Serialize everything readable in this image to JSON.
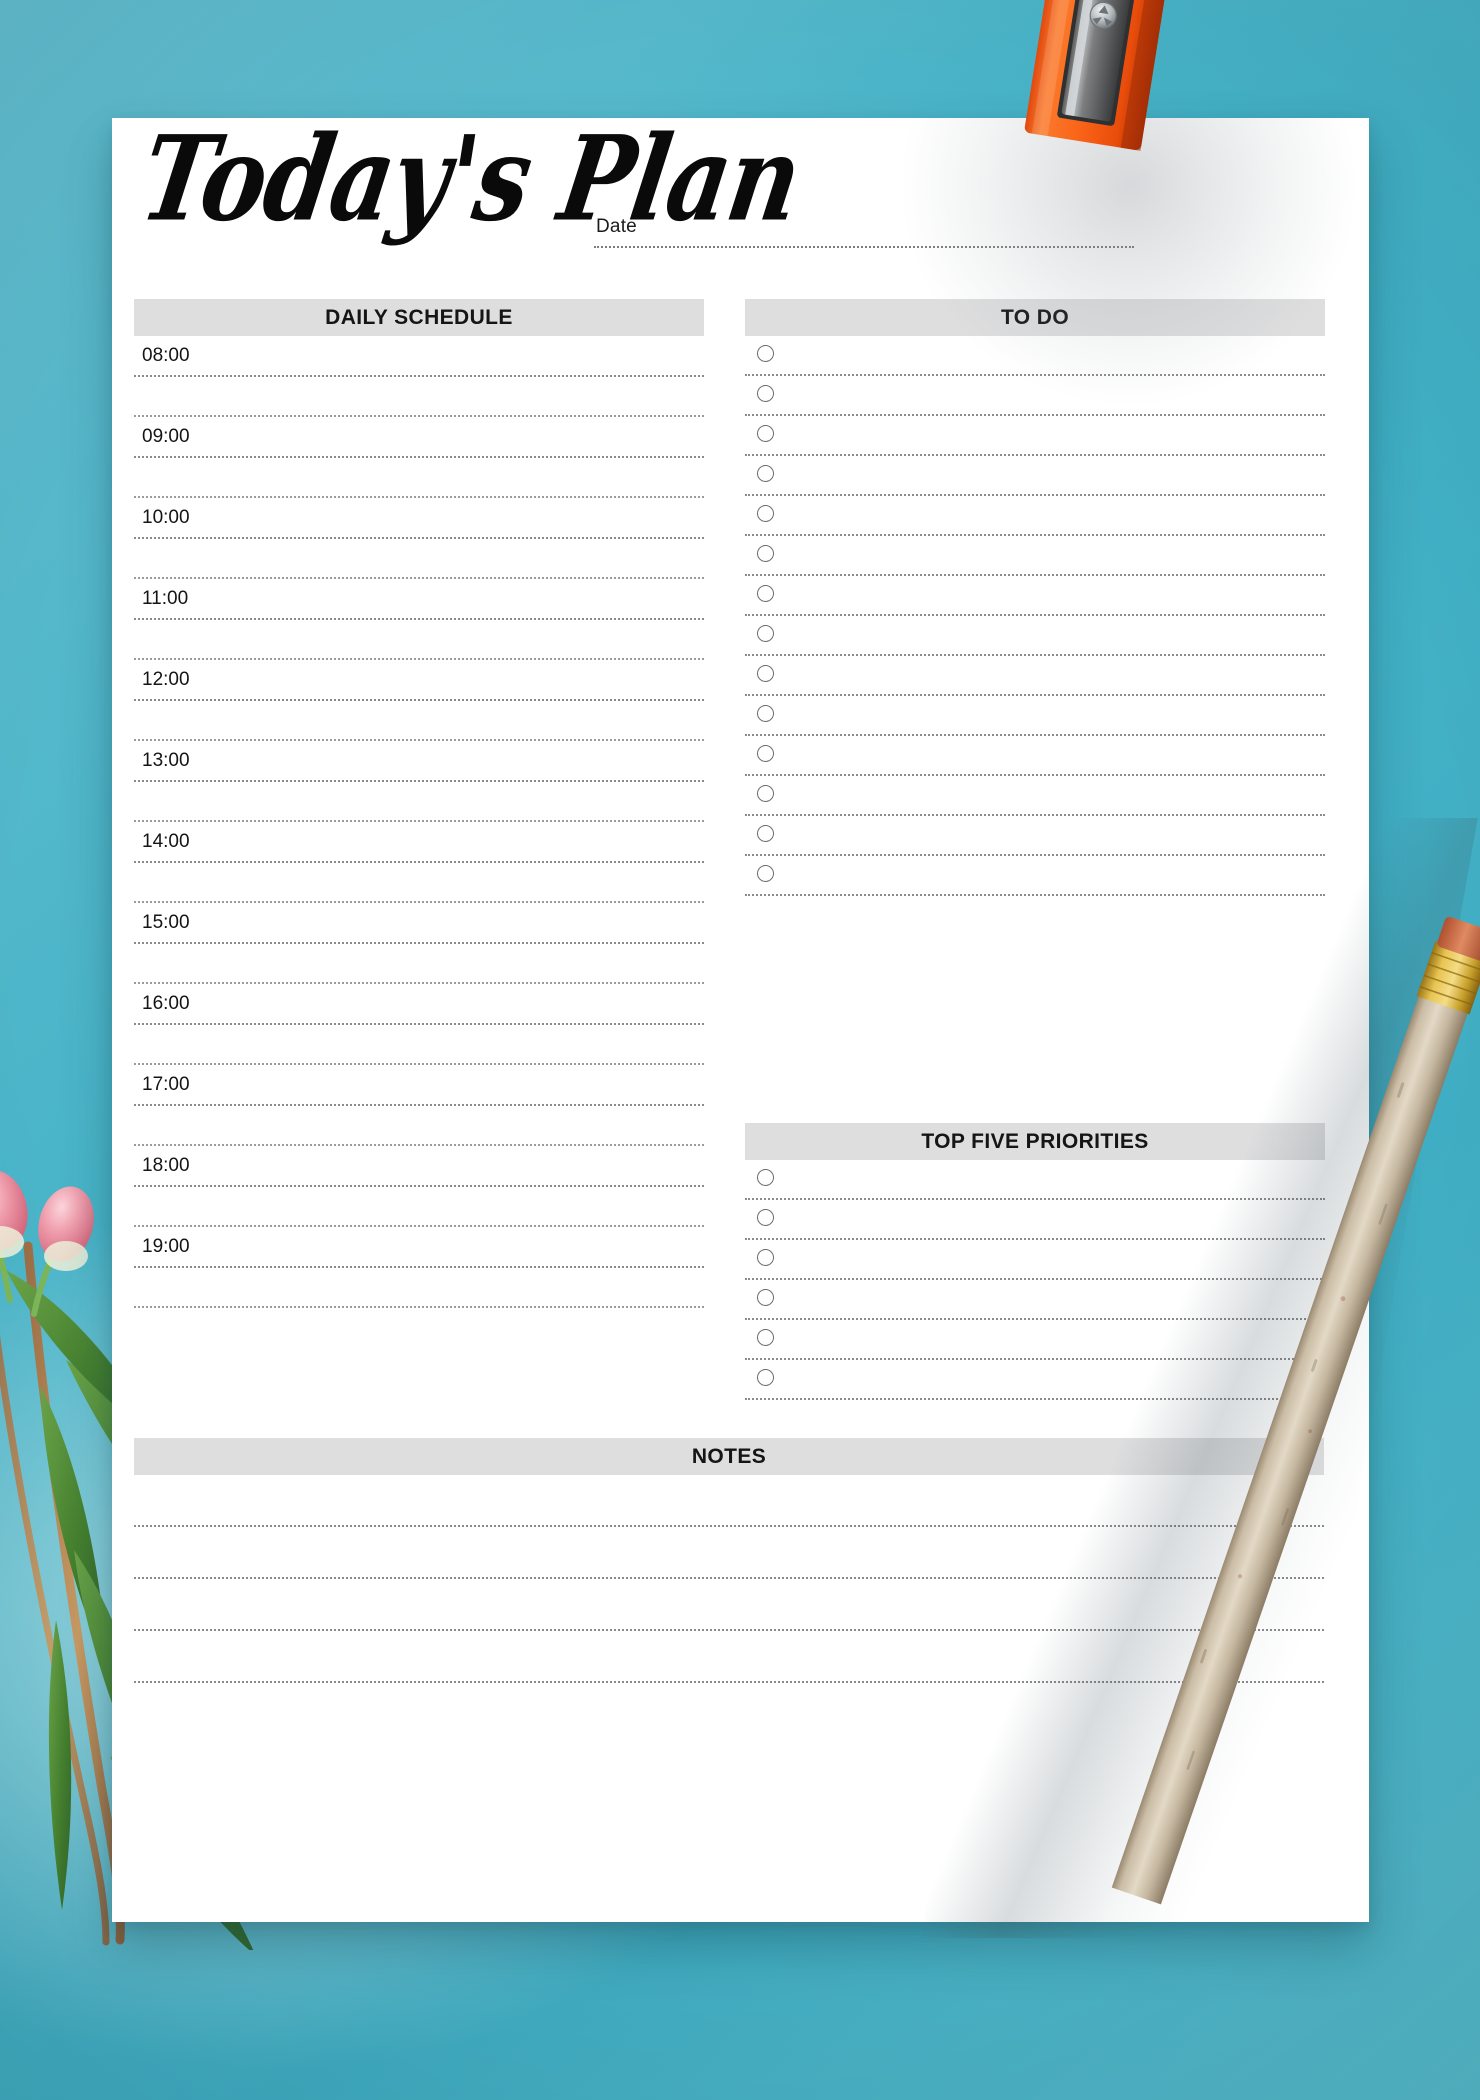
{
  "page": {
    "title": "Today's Plan",
    "paper_color": "#ffffff",
    "background_color": "#4fb6c8",
    "band_color": "#dededf",
    "rule_color": "#8a8a8a"
  },
  "header": {
    "title": "Today's Plan",
    "date_label": "Date",
    "date_value": ""
  },
  "daily_schedule": {
    "heading": "DAILY SCHEDULE",
    "hours": [
      {
        "time": "08:00",
        "entry": "",
        "half_entry": ""
      },
      {
        "time": "09:00",
        "entry": "",
        "half_entry": ""
      },
      {
        "time": "10:00",
        "entry": "",
        "half_entry": ""
      },
      {
        "time": "11:00",
        "entry": "",
        "half_entry": ""
      },
      {
        "time": "12:00",
        "entry": "",
        "half_entry": ""
      },
      {
        "time": "13:00",
        "entry": "",
        "half_entry": ""
      },
      {
        "time": "14:00",
        "entry": "",
        "half_entry": ""
      },
      {
        "time": "15:00",
        "entry": "",
        "half_entry": ""
      },
      {
        "time": "16:00",
        "entry": "",
        "half_entry": ""
      },
      {
        "time": "17:00",
        "entry": "",
        "half_entry": ""
      },
      {
        "time": "18:00",
        "entry": "",
        "half_entry": ""
      },
      {
        "time": "19:00",
        "entry": "",
        "half_entry": ""
      }
    ]
  },
  "to_do": {
    "heading": "TO DO",
    "items": [
      {
        "checked": false,
        "text": ""
      },
      {
        "checked": false,
        "text": ""
      },
      {
        "checked": false,
        "text": ""
      },
      {
        "checked": false,
        "text": ""
      },
      {
        "checked": false,
        "text": ""
      },
      {
        "checked": false,
        "text": ""
      },
      {
        "checked": false,
        "text": ""
      },
      {
        "checked": false,
        "text": ""
      },
      {
        "checked": false,
        "text": ""
      },
      {
        "checked": false,
        "text": ""
      },
      {
        "checked": false,
        "text": ""
      },
      {
        "checked": false,
        "text": ""
      },
      {
        "checked": false,
        "text": ""
      },
      {
        "checked": false,
        "text": ""
      }
    ]
  },
  "top_five_priorities": {
    "heading": "TOP FIVE PRIORITIES",
    "items": [
      {
        "checked": false,
        "text": ""
      },
      {
        "checked": false,
        "text": ""
      },
      {
        "checked": false,
        "text": ""
      },
      {
        "checked": false,
        "text": ""
      },
      {
        "checked": false,
        "text": ""
      },
      {
        "checked": false,
        "text": ""
      }
    ]
  },
  "notes": {
    "heading": "NOTES",
    "lines": [
      "",
      "",
      "",
      ""
    ]
  },
  "decor": {
    "sharpener": {
      "name": "pencil-sharpener",
      "color": "#f4601c",
      "blade_color": "#4c4c4c"
    },
    "pencil": {
      "name": "wooden-pencil",
      "ferrule_color": "#d9a528",
      "body_color": "#c6b298"
    },
    "flower_sprig": {
      "name": "pink-flower-sprig",
      "petal_color": "#ec8fa0",
      "leaf_color": "#4e8c3a"
    }
  }
}
